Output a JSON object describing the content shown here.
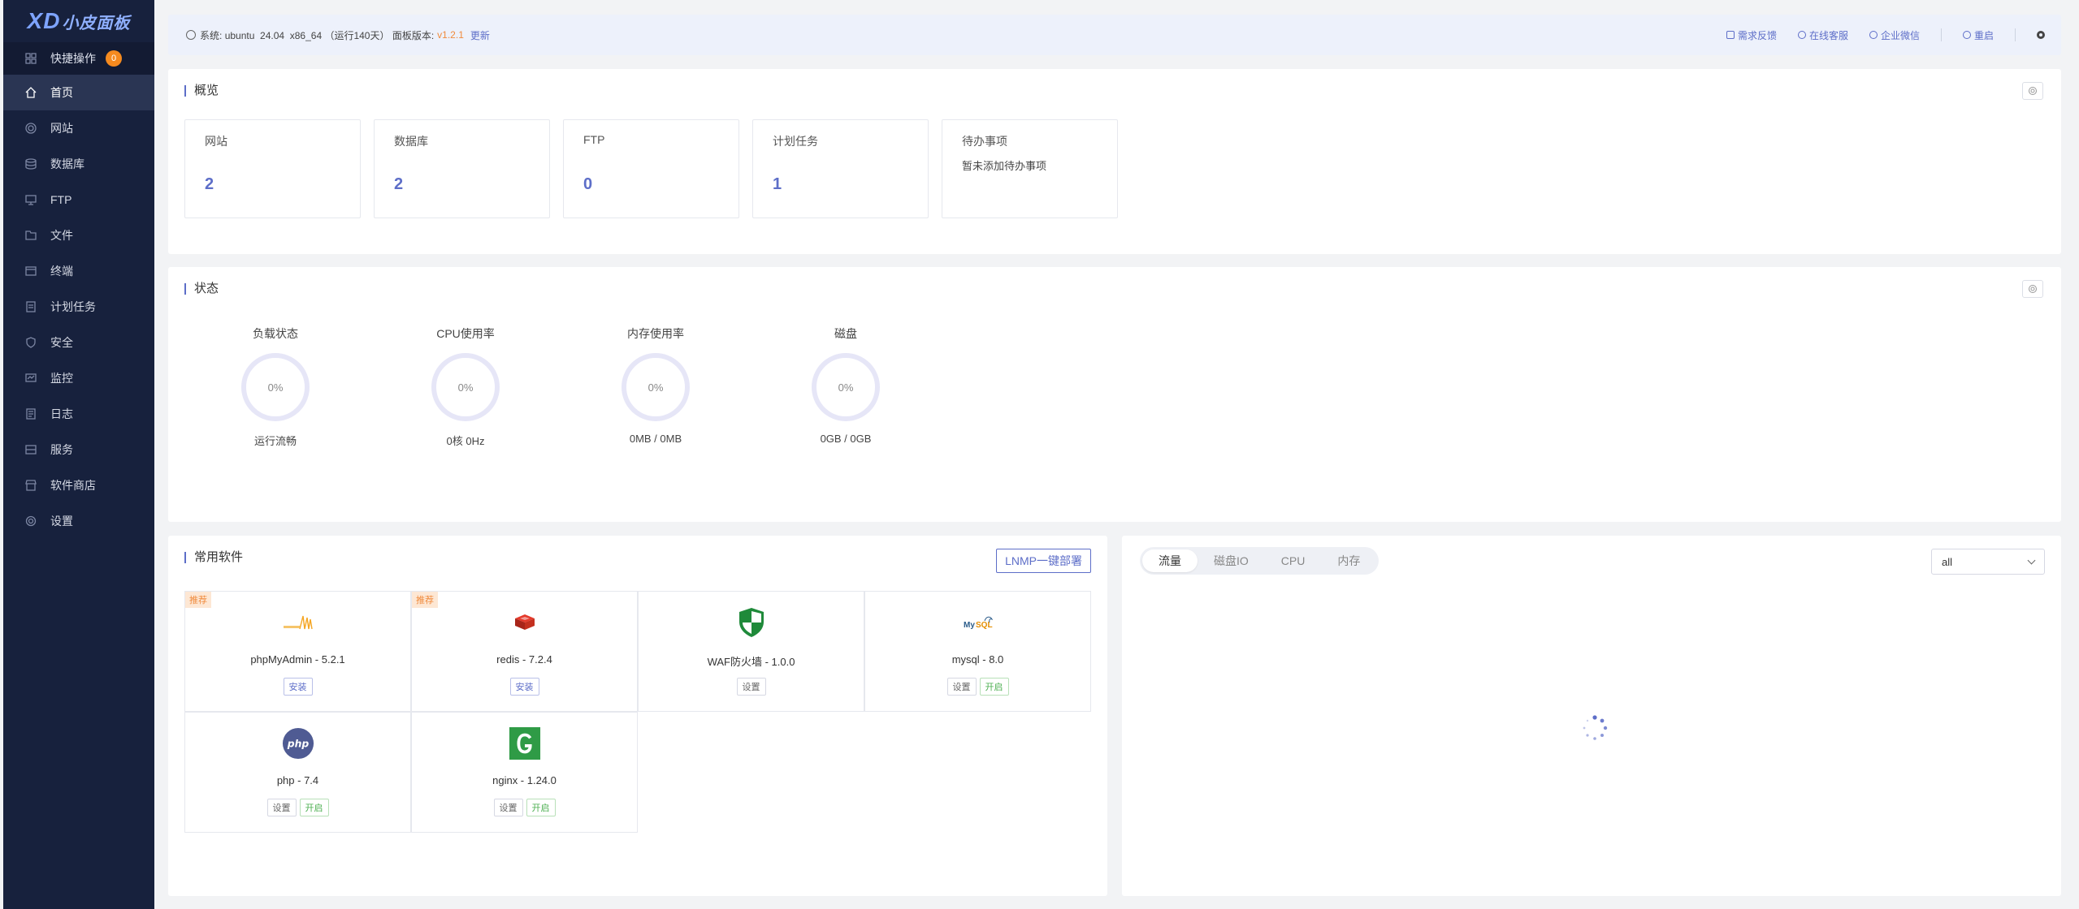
{
  "sidebar": {
    "logo_mark": "XD",
    "logo_text": "小皮面板",
    "quick_label": "快捷操作",
    "quick_count": "0",
    "items": [
      {
        "label": "首页",
        "icon": "home-icon",
        "active": true
      },
      {
        "label": "网站",
        "icon": "globe-icon"
      },
      {
        "label": "数据库",
        "icon": "database-icon"
      },
      {
        "label": "FTP",
        "icon": "ftp-icon"
      },
      {
        "label": "文件",
        "icon": "folder-icon"
      },
      {
        "label": "终端",
        "icon": "terminal-icon"
      },
      {
        "label": "计划任务",
        "icon": "task-icon"
      },
      {
        "label": "安全",
        "icon": "shield-icon"
      },
      {
        "label": "监控",
        "icon": "monitor-icon"
      },
      {
        "label": "日志",
        "icon": "log-icon"
      },
      {
        "label": "服务",
        "icon": "service-icon"
      },
      {
        "label": "软件商店",
        "icon": "store-icon"
      },
      {
        "label": "设置",
        "icon": "gear-icon"
      }
    ]
  },
  "topbar": {
    "system_label": "系统:",
    "system_value": "ubuntu  24.04  x86_64 （运行140天）",
    "version_label": "面板版本:",
    "version": "v1.2.1",
    "update": "更新",
    "links": [
      "需求反馈",
      "在线客服",
      "企业微信",
      "重启"
    ]
  },
  "overview": {
    "title": "概览",
    "boxes": [
      {
        "label": "网站",
        "value": "2"
      },
      {
        "label": "数据库",
        "value": "2"
      },
      {
        "label": "FTP",
        "value": "0"
      },
      {
        "label": "计划任务",
        "value": "1"
      }
    ],
    "todo_label": "待办事项",
    "todo_text": "暂未添加待办事项"
  },
  "status": {
    "title": "状态",
    "gauges": [
      {
        "title": "负载状态",
        "value": "0%",
        "sub": "运行流畅"
      },
      {
        "title": "CPU使用率",
        "value": "0%",
        "sub": "0核 0Hz"
      },
      {
        "title": "内存使用率",
        "value": "0%",
        "sub": "0MB / 0MB"
      },
      {
        "title": "磁盘",
        "value": "0%",
        "sub": "0GB / 0GB"
      }
    ]
  },
  "software": {
    "title": "常用软件",
    "lnmp_button": "LNMP一键部署",
    "recommend": "推荐",
    "install": "安装",
    "settings": "设置",
    "start": "开启",
    "items": [
      {
        "name": "phpMyAdmin - 5.2.1",
        "icon": "phpmyadmin-icon"
      },
      {
        "name": "redis - 7.2.4",
        "icon": "redis-icon"
      },
      {
        "name": "WAF防火墙 - 1.0.0",
        "icon": "waf-shield-icon"
      },
      {
        "name": "mysql - 8.0",
        "icon": "mysql-icon"
      },
      {
        "name": "php - 7.4",
        "icon": "php-icon"
      },
      {
        "name": "nginx - 1.24.0",
        "icon": "nginx-icon"
      }
    ]
  },
  "monitor": {
    "tabs": [
      "流量",
      "磁盘IO",
      "CPU",
      "内存"
    ],
    "select_value": "all"
  },
  "colors": {
    "sidebar_bg": "#17213d",
    "accent": "#5d6ec8",
    "orange": "#f08a3c",
    "green": "#4caf50"
  }
}
